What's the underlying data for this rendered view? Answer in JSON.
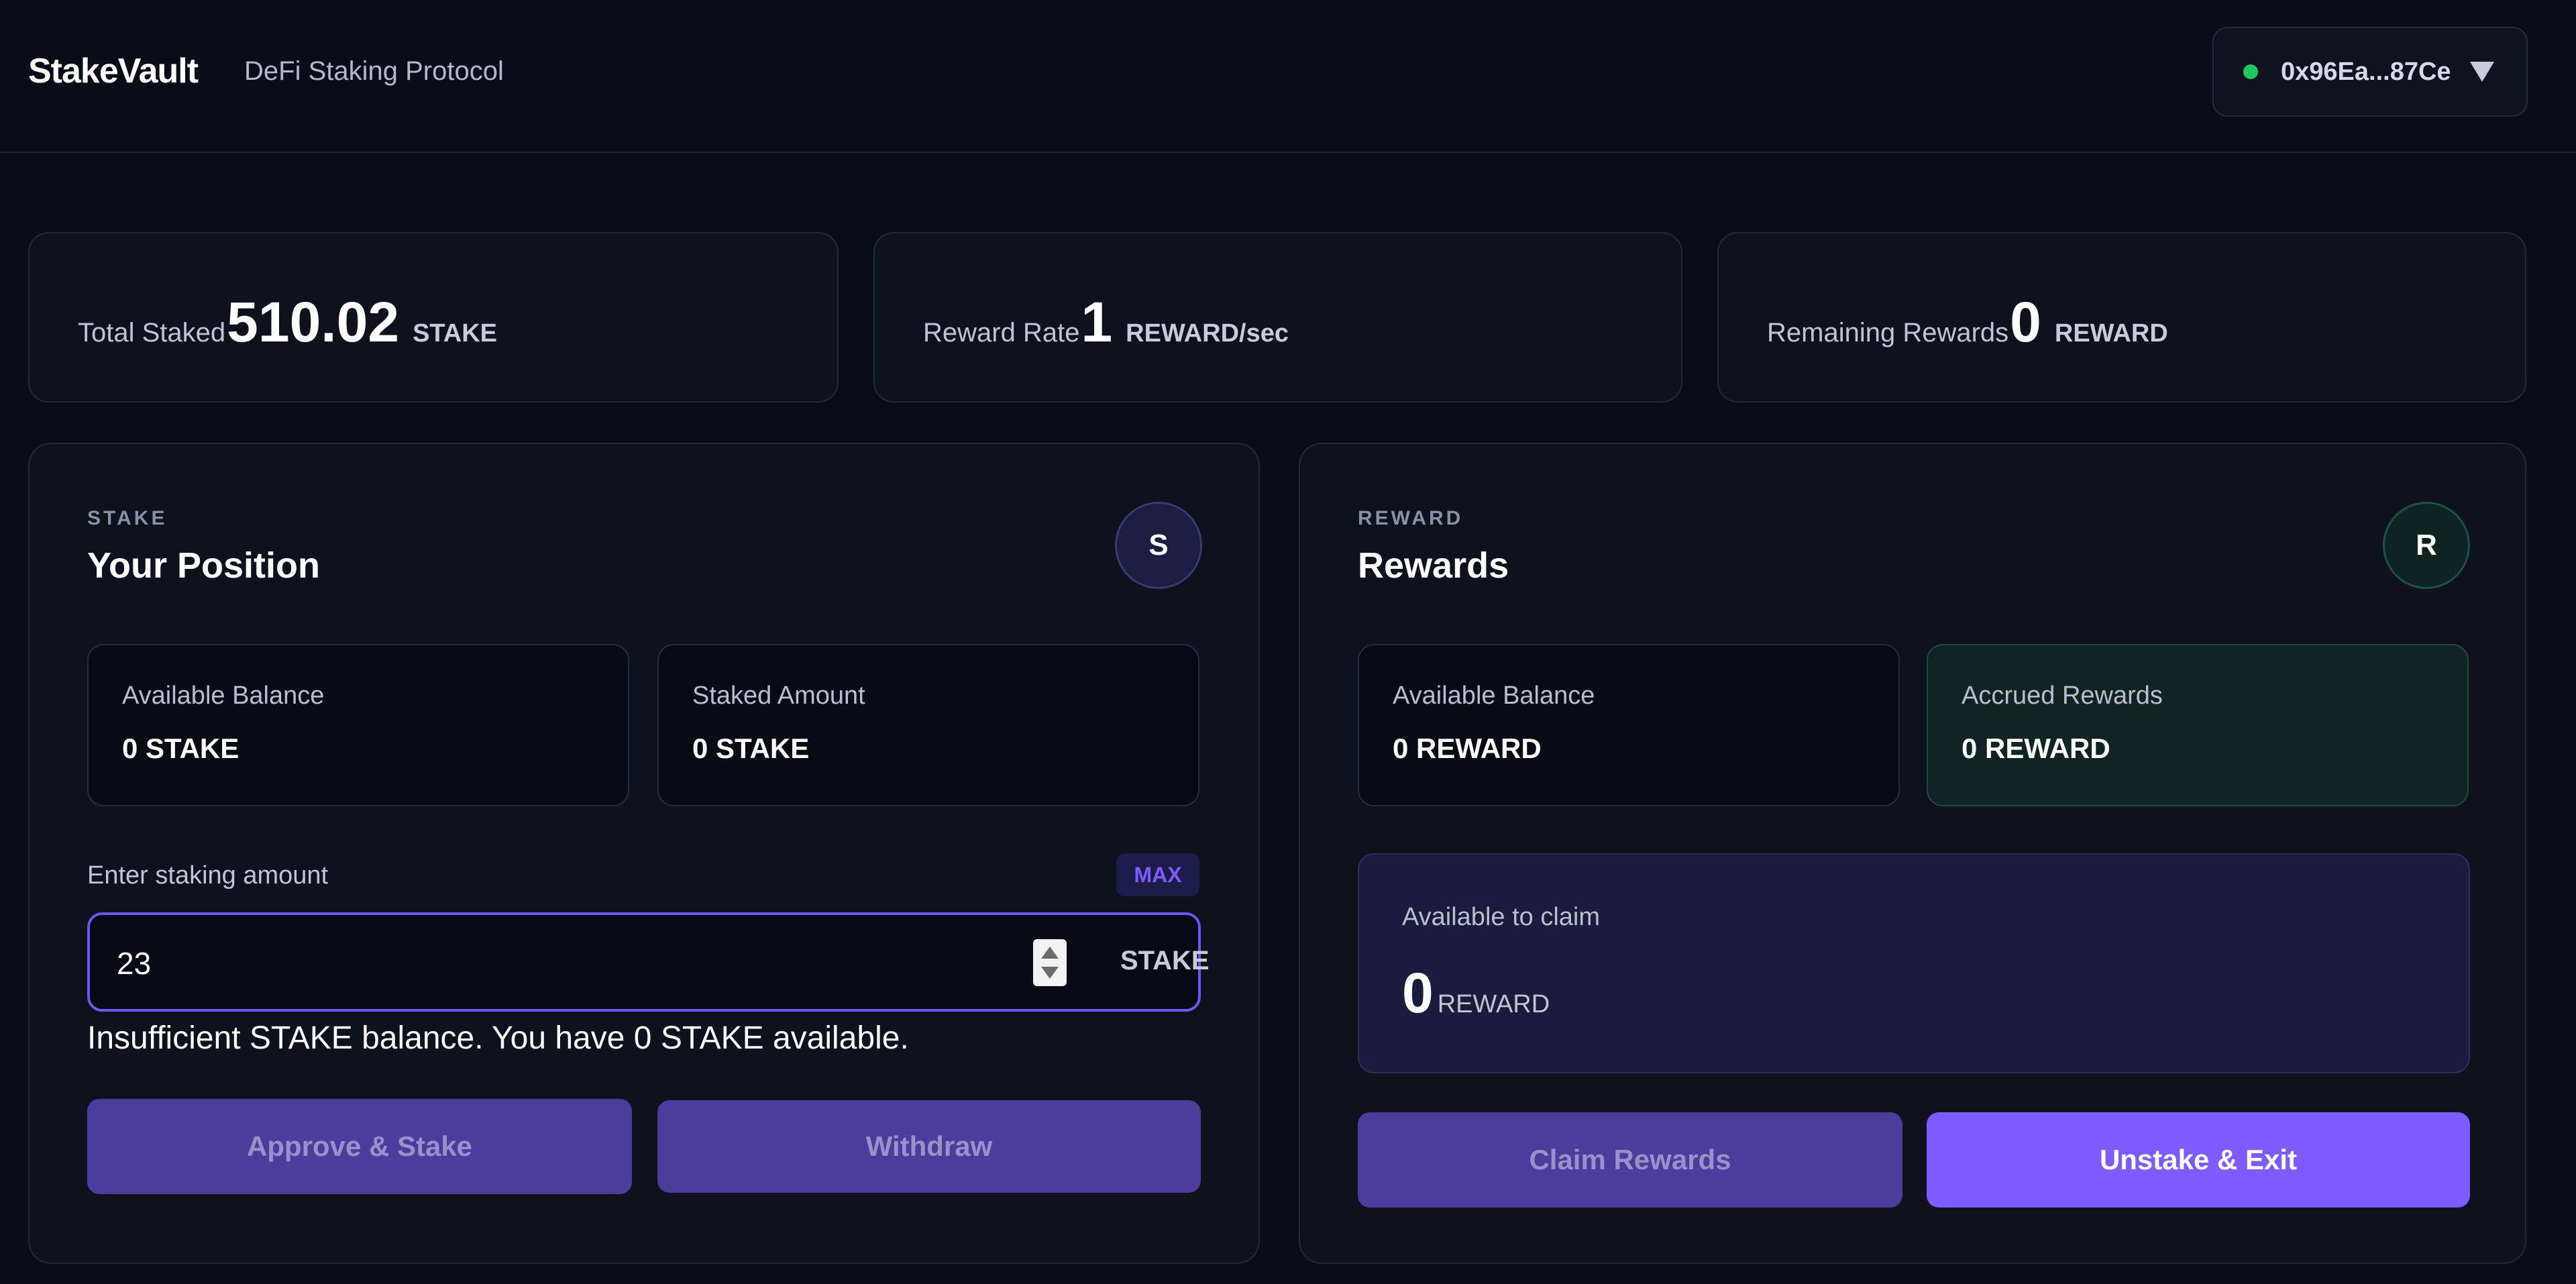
{
  "header": {
    "brand": "StakeVault",
    "tagline": "DeFi Staking Protocol",
    "wallet": {
      "address": "0x96Ea...87Ce",
      "status_color": "#22c55e",
      "caret_icon": "chevron-down-icon"
    }
  },
  "stats": [
    {
      "label": "Total Staked",
      "value": "510.02",
      "unit": "STAKE"
    },
    {
      "label": "Reward Rate",
      "value": "1",
      "unit": "REWARD/sec"
    },
    {
      "label": "Remaining Rewards",
      "value": "0",
      "unit": "REWARD"
    }
  ],
  "stake_panel": {
    "eyebrow": "STAKE",
    "title": "Your Position",
    "badge": "S",
    "available_balance": {
      "label": "Available Balance",
      "value": "0 STAKE"
    },
    "staked_amount": {
      "label": "Staked Amount",
      "value": "0 STAKE"
    },
    "amount_label": "Enter staking amount",
    "max_label": "MAX",
    "amount_value": "23",
    "amount_unit": "STAKE",
    "error": "Insufficient STAKE balance. You have 0 STAKE available.",
    "approve_label": "Approve & Stake",
    "withdraw_label": "Withdraw"
  },
  "reward_panel": {
    "eyebrow": "REWARD",
    "title": "Rewards",
    "badge": "R",
    "available_balance": {
      "label": "Available Balance",
      "value": "0 REWARD"
    },
    "accrued_rewards": {
      "label": "Accrued Rewards",
      "value": "0 REWARD"
    },
    "claim": {
      "label": "Available to claim",
      "value": "0",
      "unit": "REWARD"
    },
    "claim_label": "Claim Rewards",
    "exit_label": "Unstake & Exit"
  },
  "colors": {
    "accent": "#7c5cff",
    "accent_muted": "#4c3c9c",
    "background": "#0a0d17",
    "card": "#0e121c"
  }
}
